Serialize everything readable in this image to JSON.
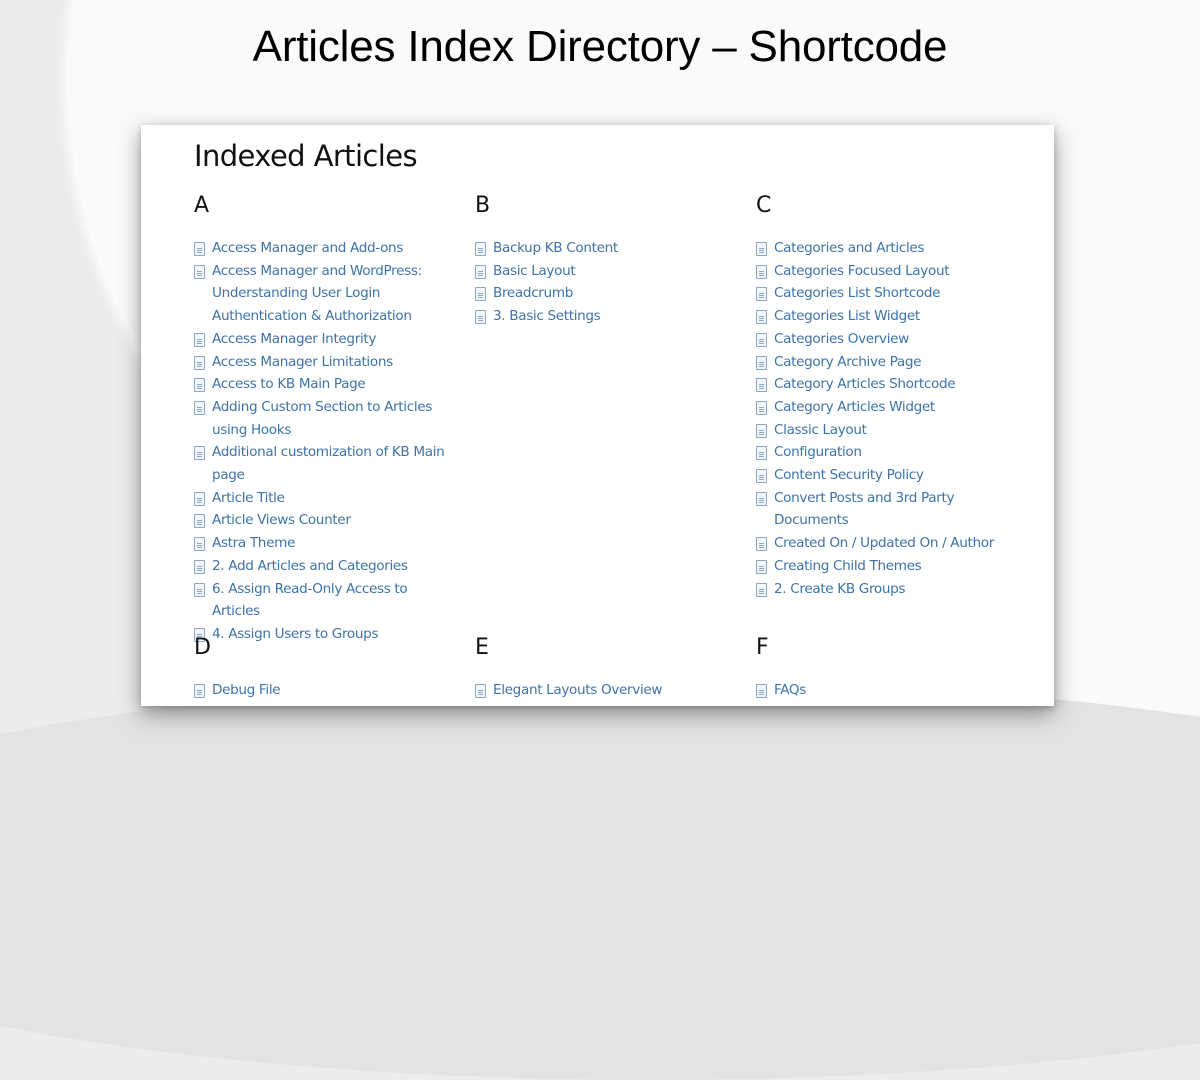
{
  "page": {
    "title": "Articles Index Directory – Shortcode"
  },
  "index": {
    "heading": "Indexed Articles",
    "sections": [
      {
        "letter": "A",
        "articles": [
          "Access Manager and Add-ons",
          "Access Manager and WordPress: Understanding User Login Authentication & Authorization",
          "Access Manager Integrity",
          "Access Manager Limitations",
          "Access to KB Main Page",
          "Adding Custom Section to Articles using Hooks",
          "Additional customization of KB Main page",
          "Article Title",
          "Article Views Counter",
          "Astra Theme",
          "2. Add Articles and Categories",
          "6. Assign Read-Only Access to Articles",
          "4. Assign Users to Groups"
        ]
      },
      {
        "letter": "B",
        "articles": [
          "Backup KB Content",
          "Basic Layout",
          "Breadcrumb",
          "3. Basic Settings"
        ]
      },
      {
        "letter": "C",
        "articles": [
          "Categories and Articles",
          "Categories Focused Layout",
          "Categories List Shortcode",
          "Categories List Widget",
          "Categories Overview",
          "Category Archive Page",
          "Category Articles Shortcode",
          "Category Articles Widget",
          "Classic Layout",
          "Configuration",
          "Content Security Policy",
          "Convert Posts and 3rd Party Documents",
          "Created On / Updated On / Author",
          "Creating Child Themes",
          "2. Create KB Groups"
        ]
      },
      {
        "letter": "D",
        "articles": [
          "Debug File"
        ]
      },
      {
        "letter": "E",
        "articles": [
          "Elegant Layouts Overview"
        ]
      },
      {
        "letter": "F",
        "articles": [
          "FAQs"
        ]
      }
    ]
  },
  "colors": {
    "link": "#3e73a8",
    "heading": "#111111"
  }
}
